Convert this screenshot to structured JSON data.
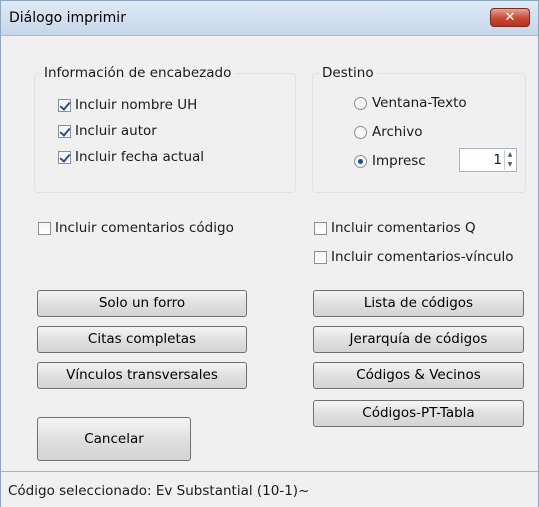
{
  "window": {
    "title": "Diálogo imprimir",
    "close_icon": "close-icon"
  },
  "header_info": {
    "title": "Información de encabezado",
    "items": [
      {
        "label": "Incluir nombre UH",
        "checked": true
      },
      {
        "label": "Incluir autor",
        "checked": true
      },
      {
        "label": "Incluir fecha actual",
        "checked": true
      }
    ]
  },
  "destination": {
    "title": "Destino",
    "options": [
      {
        "label": "Ventana-Texto",
        "selected": false
      },
      {
        "label": "Archivo",
        "selected": false
      },
      {
        "label": "Impresc",
        "selected": true
      }
    ],
    "copies": "1"
  },
  "options": {
    "code_comments": {
      "label": "Incluir comentarios código",
      "checked": false
    },
    "q_comments": {
      "label": "Incluir comentarios Q",
      "checked": false
    },
    "link_comments": {
      "label": "Incluir comentarios-vínculo",
      "checked": false
    }
  },
  "buttons": {
    "solo_forro": "Solo un forro",
    "citas": "Citas completas",
    "vinculos": "Vínculos transversales",
    "cancelar": "Cancelar",
    "lista": "Lista de códigos",
    "jerarquia": "Jerarquía de códigos",
    "vecinos": "Códigos & Vecinos",
    "pt_tabla": "Códigos-PT-Tabla"
  },
  "status": {
    "text": "Código seleccionado: Ev Substantial (10-1)~"
  }
}
